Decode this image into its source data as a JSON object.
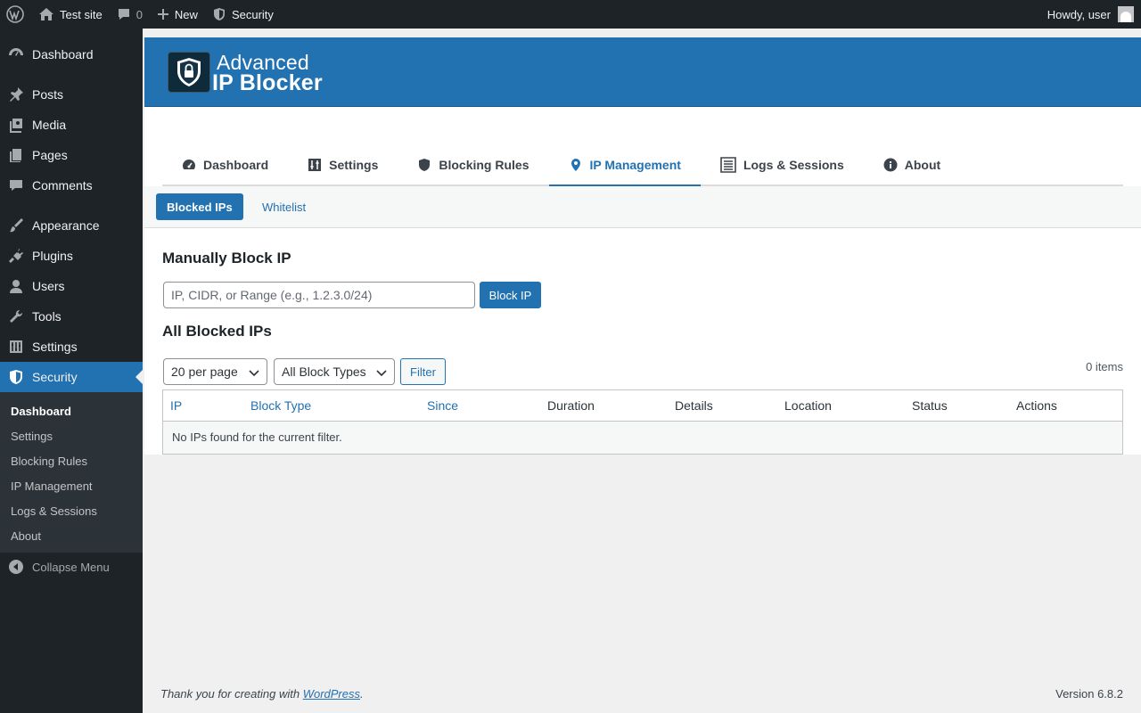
{
  "adminbar": {
    "site_name": "Test site",
    "comments_count": "0",
    "new_label": "New",
    "security_label": "Security",
    "howdy": "Howdy, user"
  },
  "sidebar": {
    "items": [
      {
        "label": "Dashboard",
        "icon": "dashboard-icon"
      },
      {
        "label": "Posts",
        "icon": "pin-icon"
      },
      {
        "label": "Media",
        "icon": "media-icon"
      },
      {
        "label": "Pages",
        "icon": "pages-icon"
      },
      {
        "label": "Comments",
        "icon": "comment-icon"
      },
      {
        "label": "Appearance",
        "icon": "brush-icon"
      },
      {
        "label": "Plugins",
        "icon": "plug-icon"
      },
      {
        "label": "Users",
        "icon": "user-icon"
      },
      {
        "label": "Tools",
        "icon": "wrench-icon"
      },
      {
        "label": "Settings",
        "icon": "sliders-icon"
      },
      {
        "label": "Security",
        "icon": "shield-icon"
      }
    ],
    "submenu": [
      "Dashboard",
      "Settings",
      "Blocking Rules",
      "IP Management",
      "Logs & Sessions",
      "About"
    ],
    "collapse_label": "Collapse Menu"
  },
  "banner": {
    "line1": "Advanced",
    "line2": "IP Blocker"
  },
  "tabs": [
    {
      "label": "Dashboard",
      "icon": "gauge-icon"
    },
    {
      "label": "Settings",
      "icon": "sliders-icon"
    },
    {
      "label": "Blocking Rules",
      "icon": "shield-icon"
    },
    {
      "label": "IP Management",
      "icon": "location-pin-icon"
    },
    {
      "label": "Logs & Sessions",
      "icon": "list-icon"
    },
    {
      "label": "About",
      "icon": "info-icon"
    }
  ],
  "subtabs": {
    "active": "Blocked IPs",
    "other": "Whitelist"
  },
  "manual_block": {
    "heading": "Manually Block IP",
    "placeholder": "IP, CIDR, or Range (e.g., 1.2.3.0/24)",
    "button": "Block IP"
  },
  "blocked_list": {
    "heading": "All Blocked IPs",
    "per_page": "20 per page",
    "block_type": "All Block Types",
    "filter_button": "Filter",
    "items_count": "0 items",
    "columns": [
      "IP",
      "Block Type",
      "Since",
      "Duration",
      "Details",
      "Location",
      "Status",
      "Actions"
    ],
    "empty_message": "No IPs found for the current filter."
  },
  "footer": {
    "thanks_prefix": "Thank you for creating with ",
    "wordpress_link": "WordPress",
    "thanks_suffix": ".",
    "version": "Version 6.8.2"
  },
  "colors": {
    "accent": "#2271b1",
    "admin_dark": "#1d2327"
  }
}
